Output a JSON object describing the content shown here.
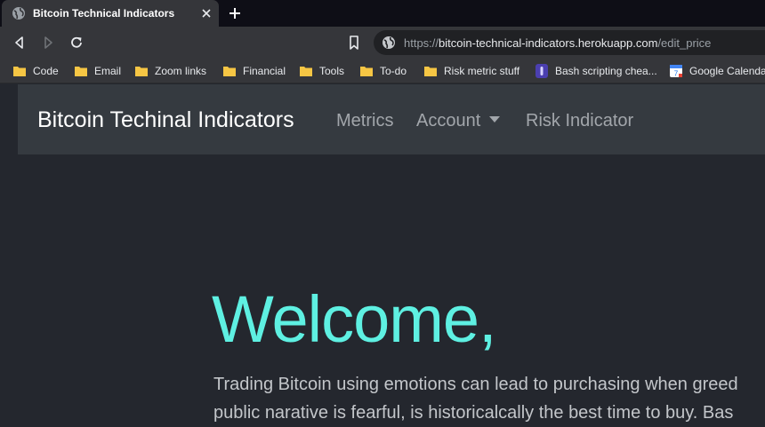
{
  "browser": {
    "tab": {
      "title": "Bitcoin Technical Indicators"
    },
    "address": {
      "scheme": "https://",
      "host": "bitcoin-technical-indicators.herokuapp.com",
      "path": "/edit_price"
    },
    "bookmarks": [
      {
        "label": "Code",
        "icon": "folder-icon"
      },
      {
        "label": "Email",
        "icon": "folder-icon"
      },
      {
        "label": "Zoom links",
        "icon": "folder-icon"
      },
      {
        "label": "Financial",
        "icon": "folder-icon"
      },
      {
        "label": "Tools",
        "icon": "folder-icon"
      },
      {
        "label": "To-do",
        "icon": "folder-icon"
      },
      {
        "label": "Risk metric stuff",
        "icon": "folder-icon"
      },
      {
        "label": "Bash scripting chea...",
        "icon": "bash-icon"
      },
      {
        "label": "Google Calendar",
        "icon": "calendar-icon"
      }
    ],
    "colors": {
      "tabstrip": "#0e0e16",
      "toolbar": "#35363a",
      "folder": "#f6c644"
    }
  },
  "site": {
    "brand": "Bitcoin Techinal Indicators",
    "nav": {
      "metrics": "Metrics",
      "account": "Account",
      "risk": "Risk Indicator"
    },
    "welcome": "Welcome,",
    "intro_line1": "Trading Bitcoin using emotions can lead to purchasing when greed",
    "intro_line2": "public narative is fearful, is historicalcally the best time to buy. Bas",
    "colors": {
      "accent": "#5ef0e2",
      "navbar": "#353a40",
      "background": "#24272e"
    }
  }
}
